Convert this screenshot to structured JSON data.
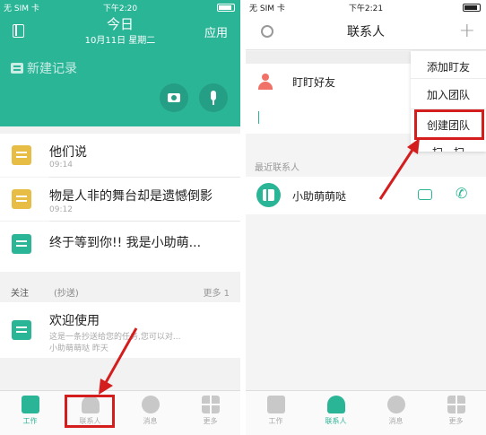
{
  "left": {
    "status": {
      "carrier": "无 SIM 卡",
      "time": "下午2:20"
    },
    "header": {
      "title": "今日",
      "date": "10月11日 星期二",
      "apps_label": "应用",
      "new_record": "新建记录"
    },
    "items": [
      {
        "title": "他们说",
        "time": "09:14"
      },
      {
        "title": "物是人非的舞台却是遗憾倒影",
        "time": "09:12"
      },
      {
        "title": "终于等到你!! 我是小助萌...",
        "time": ""
      }
    ],
    "follow": {
      "label": "关注",
      "cc": "(抄送)",
      "more": "更多 1"
    },
    "welcome": {
      "title": "欢迎使用",
      "sub1": "这是一条抄送给您的任务,您可以对...",
      "sub2": "小助萌萌哒  昨天"
    },
    "tabs": [
      "工作",
      "联系人",
      "消息",
      "更多"
    ]
  },
  "right": {
    "status": {
      "carrier": "无 SIM 卡",
      "time": "下午2:21"
    },
    "title": "联系人",
    "friends_label": "盯盯好友",
    "recent_header": "最近联系人",
    "recent_contact": "小助萌萌哒",
    "menu": [
      "添加盯友",
      "加入团队",
      "创建团队",
      "扫一扫"
    ],
    "tabs": [
      "工作",
      "联系人",
      "消息",
      "更多"
    ]
  },
  "colors": {
    "brand": "#2bb597",
    "highlight": "#d41e1e"
  }
}
